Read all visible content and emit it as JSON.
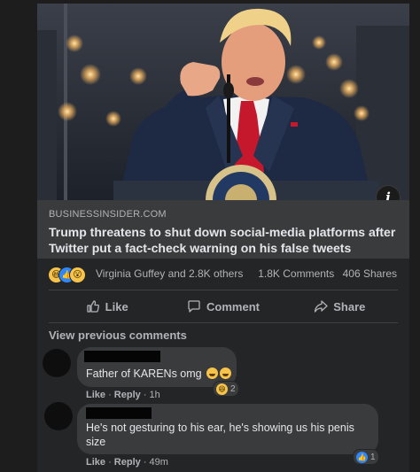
{
  "post": {
    "link_preview": {
      "image_icon": "info-icon",
      "info_label": "i",
      "source": "BUSINESSINSIDER.COM",
      "headline": "Trump threatens to shut down social-media platforms after Twitter put a fact-check warning on his false tweets"
    },
    "reactions": {
      "icons": [
        "haha-reaction-icon",
        "like-reaction-icon",
        "wow-reaction-icon"
      ],
      "summary": "Virginia Guffey and 2.8K others",
      "comments": "1.8K Comments",
      "shares": "406 Shares"
    },
    "actions": {
      "like": "Like",
      "comment": "Comment",
      "share": "Share"
    }
  },
  "comments": {
    "view_previous": "View previous comments",
    "items": [
      {
        "text": "Father of KARENs omg",
        "like": "Like",
        "reply": "Reply",
        "time": "1h",
        "reaction_icon": "haha-reaction-icon",
        "reaction_count": "2"
      },
      {
        "text": "He's not gesturing to his ear, he's showing us his penis size",
        "like": "Like",
        "reply": "Reply",
        "time": "49m",
        "reaction_icon": "like-reaction-icon",
        "reaction_count": "1"
      }
    ]
  },
  "colors": {
    "background": "#1d1d1d",
    "card": "#242526",
    "bubble": "#3a3b3c",
    "like_blue": "#2d88ff",
    "reaction_yellow": "#f7c34a"
  }
}
